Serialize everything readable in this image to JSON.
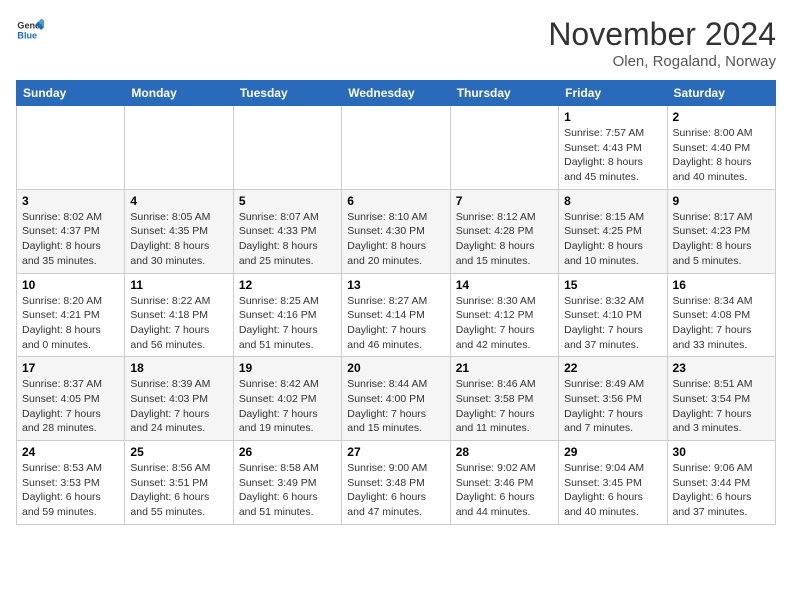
{
  "header": {
    "logo_general": "General",
    "logo_blue": "Blue",
    "month_title": "November 2024",
    "location": "Olen, Rogaland, Norway"
  },
  "weekdays": [
    "Sunday",
    "Monday",
    "Tuesday",
    "Wednesday",
    "Thursday",
    "Friday",
    "Saturday"
  ],
  "weeks": [
    [
      {
        "day": "",
        "info": ""
      },
      {
        "day": "",
        "info": ""
      },
      {
        "day": "",
        "info": ""
      },
      {
        "day": "",
        "info": ""
      },
      {
        "day": "",
        "info": ""
      },
      {
        "day": "1",
        "info": "Sunrise: 7:57 AM\nSunset: 4:43 PM\nDaylight: 8 hours\nand 45 minutes."
      },
      {
        "day": "2",
        "info": "Sunrise: 8:00 AM\nSunset: 4:40 PM\nDaylight: 8 hours\nand 40 minutes."
      }
    ],
    [
      {
        "day": "3",
        "info": "Sunrise: 8:02 AM\nSunset: 4:37 PM\nDaylight: 8 hours\nand 35 minutes."
      },
      {
        "day": "4",
        "info": "Sunrise: 8:05 AM\nSunset: 4:35 PM\nDaylight: 8 hours\nand 30 minutes."
      },
      {
        "day": "5",
        "info": "Sunrise: 8:07 AM\nSunset: 4:33 PM\nDaylight: 8 hours\nand 25 minutes."
      },
      {
        "day": "6",
        "info": "Sunrise: 8:10 AM\nSunset: 4:30 PM\nDaylight: 8 hours\nand 20 minutes."
      },
      {
        "day": "7",
        "info": "Sunrise: 8:12 AM\nSunset: 4:28 PM\nDaylight: 8 hours\nand 15 minutes."
      },
      {
        "day": "8",
        "info": "Sunrise: 8:15 AM\nSunset: 4:25 PM\nDaylight: 8 hours\nand 10 minutes."
      },
      {
        "day": "9",
        "info": "Sunrise: 8:17 AM\nSunset: 4:23 PM\nDaylight: 8 hours\nand 5 minutes."
      }
    ],
    [
      {
        "day": "10",
        "info": "Sunrise: 8:20 AM\nSunset: 4:21 PM\nDaylight: 8 hours\nand 0 minutes."
      },
      {
        "day": "11",
        "info": "Sunrise: 8:22 AM\nSunset: 4:18 PM\nDaylight: 7 hours\nand 56 minutes."
      },
      {
        "day": "12",
        "info": "Sunrise: 8:25 AM\nSunset: 4:16 PM\nDaylight: 7 hours\nand 51 minutes."
      },
      {
        "day": "13",
        "info": "Sunrise: 8:27 AM\nSunset: 4:14 PM\nDaylight: 7 hours\nand 46 minutes."
      },
      {
        "day": "14",
        "info": "Sunrise: 8:30 AM\nSunset: 4:12 PM\nDaylight: 7 hours\nand 42 minutes."
      },
      {
        "day": "15",
        "info": "Sunrise: 8:32 AM\nSunset: 4:10 PM\nDaylight: 7 hours\nand 37 minutes."
      },
      {
        "day": "16",
        "info": "Sunrise: 8:34 AM\nSunset: 4:08 PM\nDaylight: 7 hours\nand 33 minutes."
      }
    ],
    [
      {
        "day": "17",
        "info": "Sunrise: 8:37 AM\nSunset: 4:05 PM\nDaylight: 7 hours\nand 28 minutes."
      },
      {
        "day": "18",
        "info": "Sunrise: 8:39 AM\nSunset: 4:03 PM\nDaylight: 7 hours\nand 24 minutes."
      },
      {
        "day": "19",
        "info": "Sunrise: 8:42 AM\nSunset: 4:02 PM\nDaylight: 7 hours\nand 19 minutes."
      },
      {
        "day": "20",
        "info": "Sunrise: 8:44 AM\nSunset: 4:00 PM\nDaylight: 7 hours\nand 15 minutes."
      },
      {
        "day": "21",
        "info": "Sunrise: 8:46 AM\nSunset: 3:58 PM\nDaylight: 7 hours\nand 11 minutes."
      },
      {
        "day": "22",
        "info": "Sunrise: 8:49 AM\nSunset: 3:56 PM\nDaylight: 7 hours\nand 7 minutes."
      },
      {
        "day": "23",
        "info": "Sunrise: 8:51 AM\nSunset: 3:54 PM\nDaylight: 7 hours\nand 3 minutes."
      }
    ],
    [
      {
        "day": "24",
        "info": "Sunrise: 8:53 AM\nSunset: 3:53 PM\nDaylight: 6 hours\nand 59 minutes."
      },
      {
        "day": "25",
        "info": "Sunrise: 8:56 AM\nSunset: 3:51 PM\nDaylight: 6 hours\nand 55 minutes."
      },
      {
        "day": "26",
        "info": "Sunrise: 8:58 AM\nSunset: 3:49 PM\nDaylight: 6 hours\nand 51 minutes."
      },
      {
        "day": "27",
        "info": "Sunrise: 9:00 AM\nSunset: 3:48 PM\nDaylight: 6 hours\nand 47 minutes."
      },
      {
        "day": "28",
        "info": "Sunrise: 9:02 AM\nSunset: 3:46 PM\nDaylight: 6 hours\nand 44 minutes."
      },
      {
        "day": "29",
        "info": "Sunrise: 9:04 AM\nSunset: 3:45 PM\nDaylight: 6 hours\nand 40 minutes."
      },
      {
        "day": "30",
        "info": "Sunrise: 9:06 AM\nSunset: 3:44 PM\nDaylight: 6 hours\nand 37 minutes."
      }
    ]
  ]
}
